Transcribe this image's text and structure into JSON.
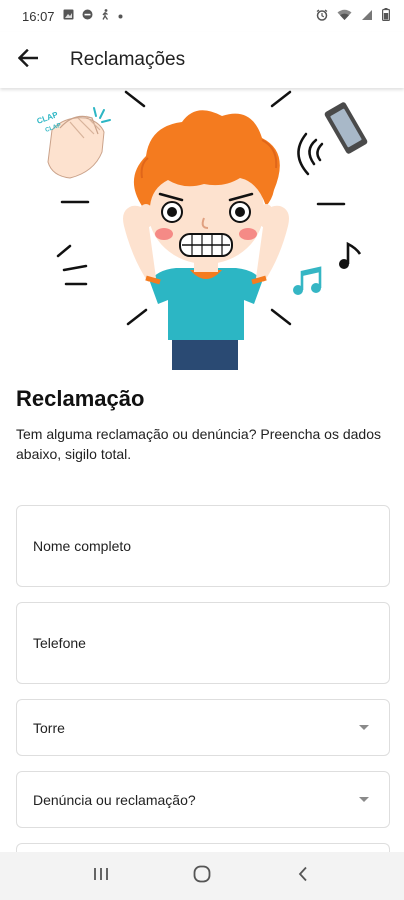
{
  "status_bar": {
    "time": "16:07",
    "left_icons": [
      "image-icon",
      "block-icon",
      "walk-icon",
      "dot-icon"
    ],
    "right_icons": [
      "alarm-icon",
      "wifi-icon",
      "signal-icon",
      "battery-icon"
    ]
  },
  "app_bar": {
    "title": "Reclamações",
    "back_icon": "arrow-left-icon"
  },
  "hero": {
    "badge_text_1": "CLAP",
    "badge_text_2": "CLAP",
    "colors": {
      "hair": "#f47b1f",
      "skin": "#fde2cf",
      "shirt": "#2cb6c4",
      "pants": "#2a4a73",
      "music": "#35b6c4"
    }
  },
  "section": {
    "title": "Reclamação",
    "description": "Tem alguma reclamação ou denúncia? Preencha os dados abaixo, sigilo total."
  },
  "form": {
    "name_placeholder": "Nome completo",
    "phone_placeholder": "Telefone",
    "tower_select": "Torre",
    "type_select": "Denúncia ou reclamação?"
  },
  "nav_bar": {
    "recent_icon": "recent-apps-icon",
    "home_icon": "home-icon",
    "back_icon": "nav-back-icon"
  }
}
